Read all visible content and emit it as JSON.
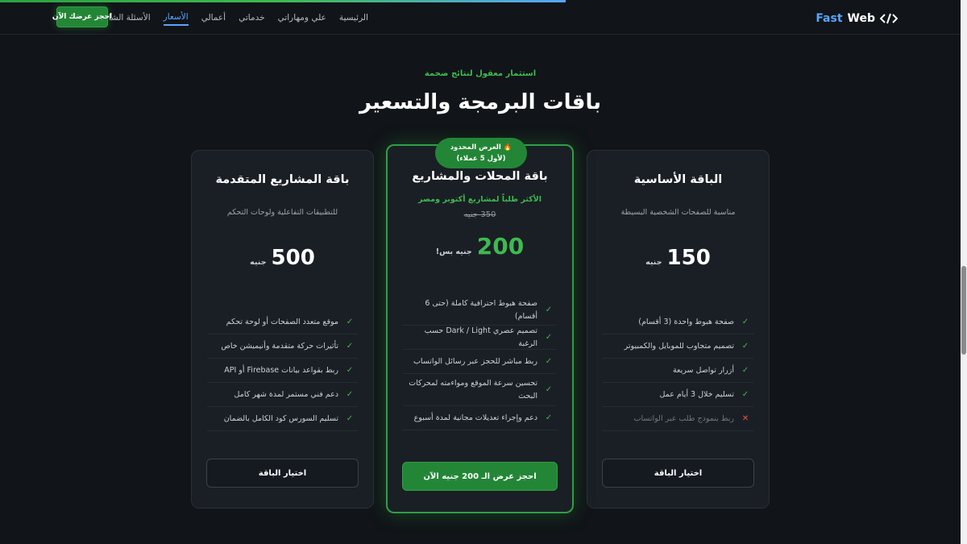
{
  "header": {
    "brand": {
      "part1": "Fast",
      "part2": "Web"
    },
    "nav": [
      {
        "label": "الرئيسية",
        "active": false
      },
      {
        "label": "علي ومهاراتي",
        "active": false
      },
      {
        "label": "خدماتي",
        "active": false
      },
      {
        "label": "أعمالي",
        "active": false
      },
      {
        "label": "الأسعار",
        "active": true
      },
      {
        "label": "الأسئلة الشائعة",
        "active": false
      }
    ],
    "cta": "احجز عرضك الآن"
  },
  "progress": {
    "percent": 58.5
  },
  "section": {
    "eyebrow": "استثمار معقول لنتائج ضخمة",
    "title": "باقات البرمجة والتسعير"
  },
  "plans": {
    "basic": {
      "title": "الباقة الأساسية",
      "subtitle": "مناسبة للصفحات الشخصية البسيطة",
      "price": "150",
      "currency": "جنيه",
      "features": [
        {
          "text": "صفحة هبوط واحدة (3 أقسام)",
          "included": true
        },
        {
          "text": "تصميم متجاوب للموبايل والكمبيوتر",
          "included": true
        },
        {
          "text": "أزرار تواصل سريعة",
          "included": true
        },
        {
          "text": "تسليم خلال 3 أيام عمل",
          "included": true
        },
        {
          "text": "ربط بنموذج طلب عبر الواتساب",
          "included": false
        }
      ],
      "button": "اختيار الباقة"
    },
    "featured": {
      "badge_line1": "🔥 العرض المحدود",
      "badge_line2": "(لأول 5 عملاء)",
      "title": "باقة المحلات والمشاريع",
      "subtitle": "الأكثر طلباً لمشاريع أكتوبر ومصر",
      "old_price": "350 جنيه",
      "price": "200",
      "currency": "جنيه بس!",
      "features": [
        {
          "text": "صفحة هبوط احترافية كاملة (حتى 6 أقسام)",
          "included": true
        },
        {
          "text": "تصميم عصري Dark / Light حسب الرغبة",
          "included": true
        },
        {
          "text": "ربط مباشر للحجز عبر رسائل الواتساب",
          "included": true
        },
        {
          "text": "تحسين سرعة الموقع ومواءمته لمحركات البحث",
          "included": true
        },
        {
          "text": "دعم وإجراء تعديلات مجانية لمدة أسبوع",
          "included": true
        }
      ],
      "button": "احجز عرض الـ 200 جنيه الآن"
    },
    "pro": {
      "title": "باقة المشاريع المتقدمة",
      "subtitle": "للتطبيقات التفاعلية ولوحات التحكم",
      "price": "500",
      "currency": "جنيه",
      "features": [
        {
          "text": "موقع متعدد الصفحات أو لوحة تحكم",
          "included": true
        },
        {
          "text": "تأثيرات حركة متقدمة وأنيميشن خاص",
          "included": true
        },
        {
          "text": "ربط بقواعد بيانات Firebase أو API",
          "included": true
        },
        {
          "text": "دعم فني مستمر لمدة شهر كامل",
          "included": true
        },
        {
          "text": "تسليم السورس كود الكامل بالضمان",
          "included": true
        }
      ],
      "button": "اختيار الباقة"
    }
  },
  "colors": {
    "accent": "#3fb950",
    "link": "#58a6ff",
    "background": "#111418",
    "card": "#1a1f25"
  },
  "icons": {
    "check": "check-icon",
    "cross": "close-icon",
    "brand": "code-icon"
  }
}
